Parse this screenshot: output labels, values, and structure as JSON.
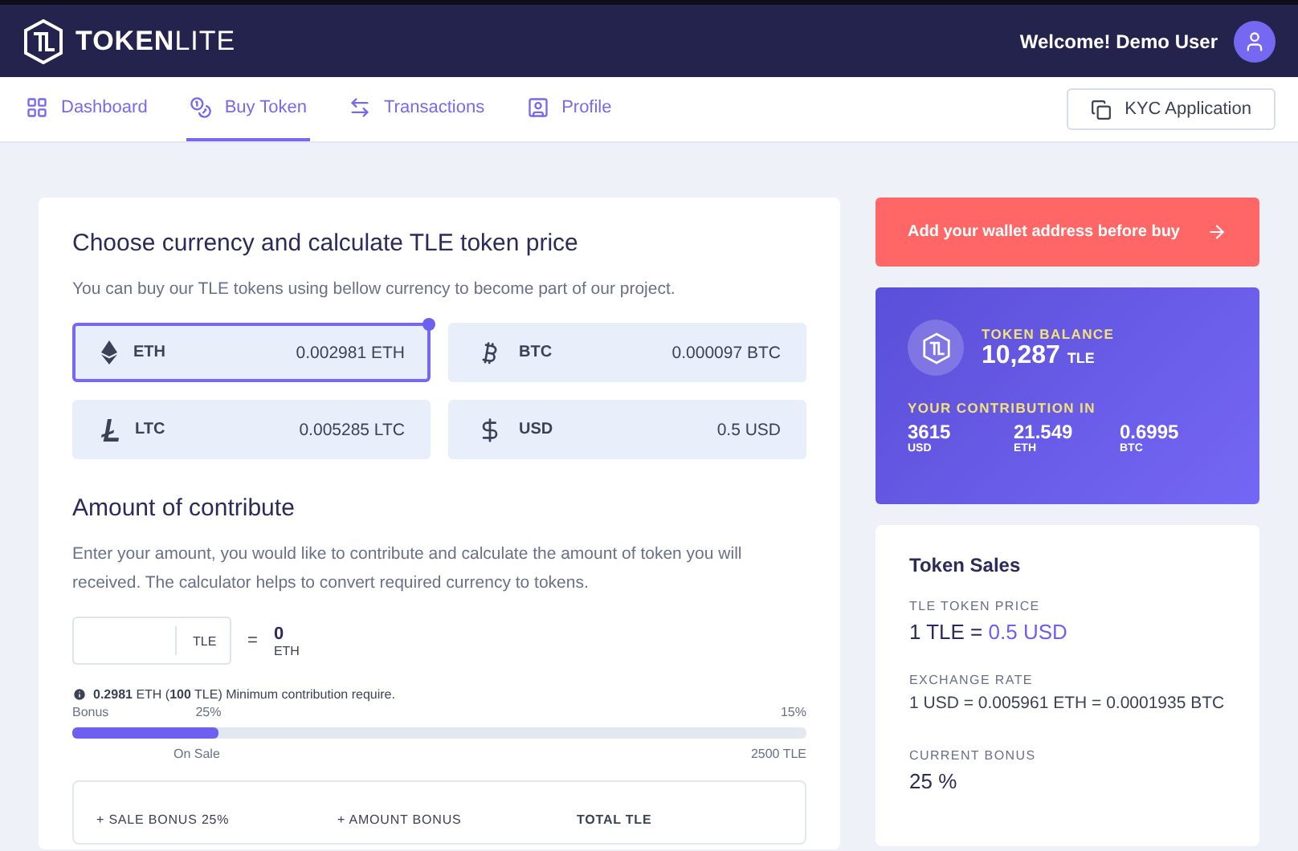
{
  "header": {
    "brand_bold": "TOKEN",
    "brand_light": "LITE",
    "welcome": "Welcome! Demo User"
  },
  "nav": {
    "items": [
      {
        "label": "Dashboard",
        "selected": false
      },
      {
        "label": "Buy Token",
        "selected": true
      },
      {
        "label": "Transactions",
        "selected": false
      },
      {
        "label": "Profile",
        "selected": false
      }
    ],
    "kyc_button": "KYC Application"
  },
  "currency": {
    "title": "Choose currency and calculate TLE token price",
    "subtitle": "You can buy our TLE tokens using bellow currency to become part of our project.",
    "options": [
      {
        "code": "ETH",
        "price": "0.002981 ETH",
        "selected": true
      },
      {
        "code": "BTC",
        "price": "0.000097 BTC",
        "selected": false
      },
      {
        "code": "LTC",
        "price": "0.005285 LTC",
        "selected": false
      },
      {
        "code": "USD",
        "price": "0.5 USD",
        "selected": false
      }
    ]
  },
  "contribute": {
    "title": "Amount of contribute",
    "text": "Enter your amount, you would like to contribute and calculate the amount of token you will received. The calculator helps to convert required currency to tokens.",
    "unit": "TLE",
    "equals": "=",
    "result": "0",
    "result_unit": "ETH",
    "note": "**0.2981** ETH (**100** TLE) Minimum contribution require.",
    "bonus": {
      "label": "Bonus",
      "first_pct": "25%",
      "last_pct": "15%",
      "level": 0.2,
      "first_caption": "On Sale",
      "last_caption": "2500 TLE"
    },
    "summary": [
      "+ SALE BONUS 25%",
      "+ AMOUNT BONUS",
      "TOTAL TLE"
    ]
  },
  "wallet_button": "Add your wallet address before buy",
  "balance": {
    "label": "TOKEN BALANCE",
    "amount": "10,287",
    "unit": "TLE",
    "contribution_label": "YOUR CONTRIBUTION IN",
    "contributions": [
      {
        "value": "3615",
        "unit": "USD"
      },
      {
        "value": "21.549",
        "unit": "ETH"
      },
      {
        "value": "0.6995",
        "unit": "BTC"
      }
    ]
  },
  "sales": {
    "title": "Token Sales",
    "price_label": "TLE TOKEN PRICE",
    "price_prefix": "1 TLE = ",
    "price_value": "0.5 USD",
    "rate_label": "EXCHANGE RATE",
    "rate": "1 USD = 0.005961 ETH = 0.0001935 BTC",
    "bonus_label": "CURRENT BONUS",
    "bonus_value": "25 %"
  }
}
